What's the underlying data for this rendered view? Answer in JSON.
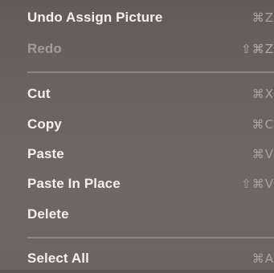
{
  "menu": {
    "items": [
      {
        "label": "Undo Assign Picture",
        "shortcut": "⌘Z",
        "enabled": true
      },
      {
        "label": "Redo",
        "shortcut": "⇧⌘Z",
        "enabled": false
      },
      {
        "label": "Cut",
        "shortcut": "⌘X",
        "enabled": true
      },
      {
        "label": "Copy",
        "shortcut": "⌘C",
        "enabled": true
      },
      {
        "label": "Paste",
        "shortcut": "⌘V",
        "enabled": true
      },
      {
        "label": "Paste In Place",
        "shortcut": "⇧⌘V",
        "enabled": true
      },
      {
        "label": "Delete",
        "shortcut": "",
        "enabled": true
      },
      {
        "label": "Select All",
        "shortcut": "⌘A",
        "enabled": true
      }
    ]
  },
  "colors": {
    "menu_background": "#6a635f",
    "label_text": "#f2efec",
    "disabled_text": "#a29b97",
    "shortcut_text": "#aaa39f",
    "separator": "#8b8480"
  }
}
